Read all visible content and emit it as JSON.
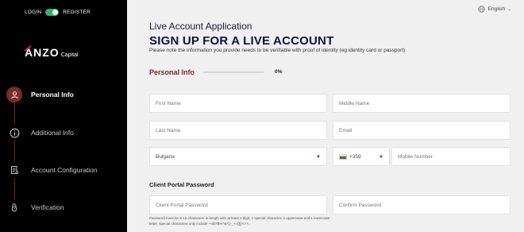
{
  "auth_toggle": {
    "left_label": "LOGIN",
    "right_label": "REGISTER"
  },
  "logo": {
    "brand": "NZO",
    "brand_prefix": "A",
    "suffix": "Capital"
  },
  "steps": [
    {
      "label": "Personal Info",
      "icon": "user-icon",
      "active": true
    },
    {
      "label": "Additional Info",
      "icon": "info-icon",
      "active": false
    },
    {
      "label": "Account Configuration",
      "icon": "document-icon",
      "active": false
    },
    {
      "label": "Verification",
      "icon": "lock-icon",
      "active": false
    }
  ],
  "language": {
    "label": "English",
    "icon": "globe-icon"
  },
  "header": {
    "subtitle": "Live Account Application",
    "title": "SIGN UP FOR A LIVE ACCOUNT",
    "note": "Please note the information you provide needs to be verifiable with proof of identity (eg identity card or passport)"
  },
  "section": {
    "title": "Personal Info",
    "progress_text": "0%",
    "progress": 0
  },
  "form": {
    "first_name": "First Name",
    "middle_name": "Middle Name",
    "last_name": "Last Name",
    "email": "Email",
    "country": "Bulgaria",
    "phone_code": "+359",
    "mobile": "Mobile Number",
    "password_title": "Client Portal Password",
    "password": "Client Portal Password",
    "confirm_password": "Confirm Password",
    "password_hint": "Password must be 8-15 characters in length with at least 1 digit, 1 special character, 1 uppercase and 1 lowercase letter, special characters only include ~!@#$%^&*()-_+=[]{}<>?,."
  },
  "colors": {
    "accent": "#7a2323",
    "sidebar_bg": "#000000",
    "toggle": "#2fb36b"
  }
}
